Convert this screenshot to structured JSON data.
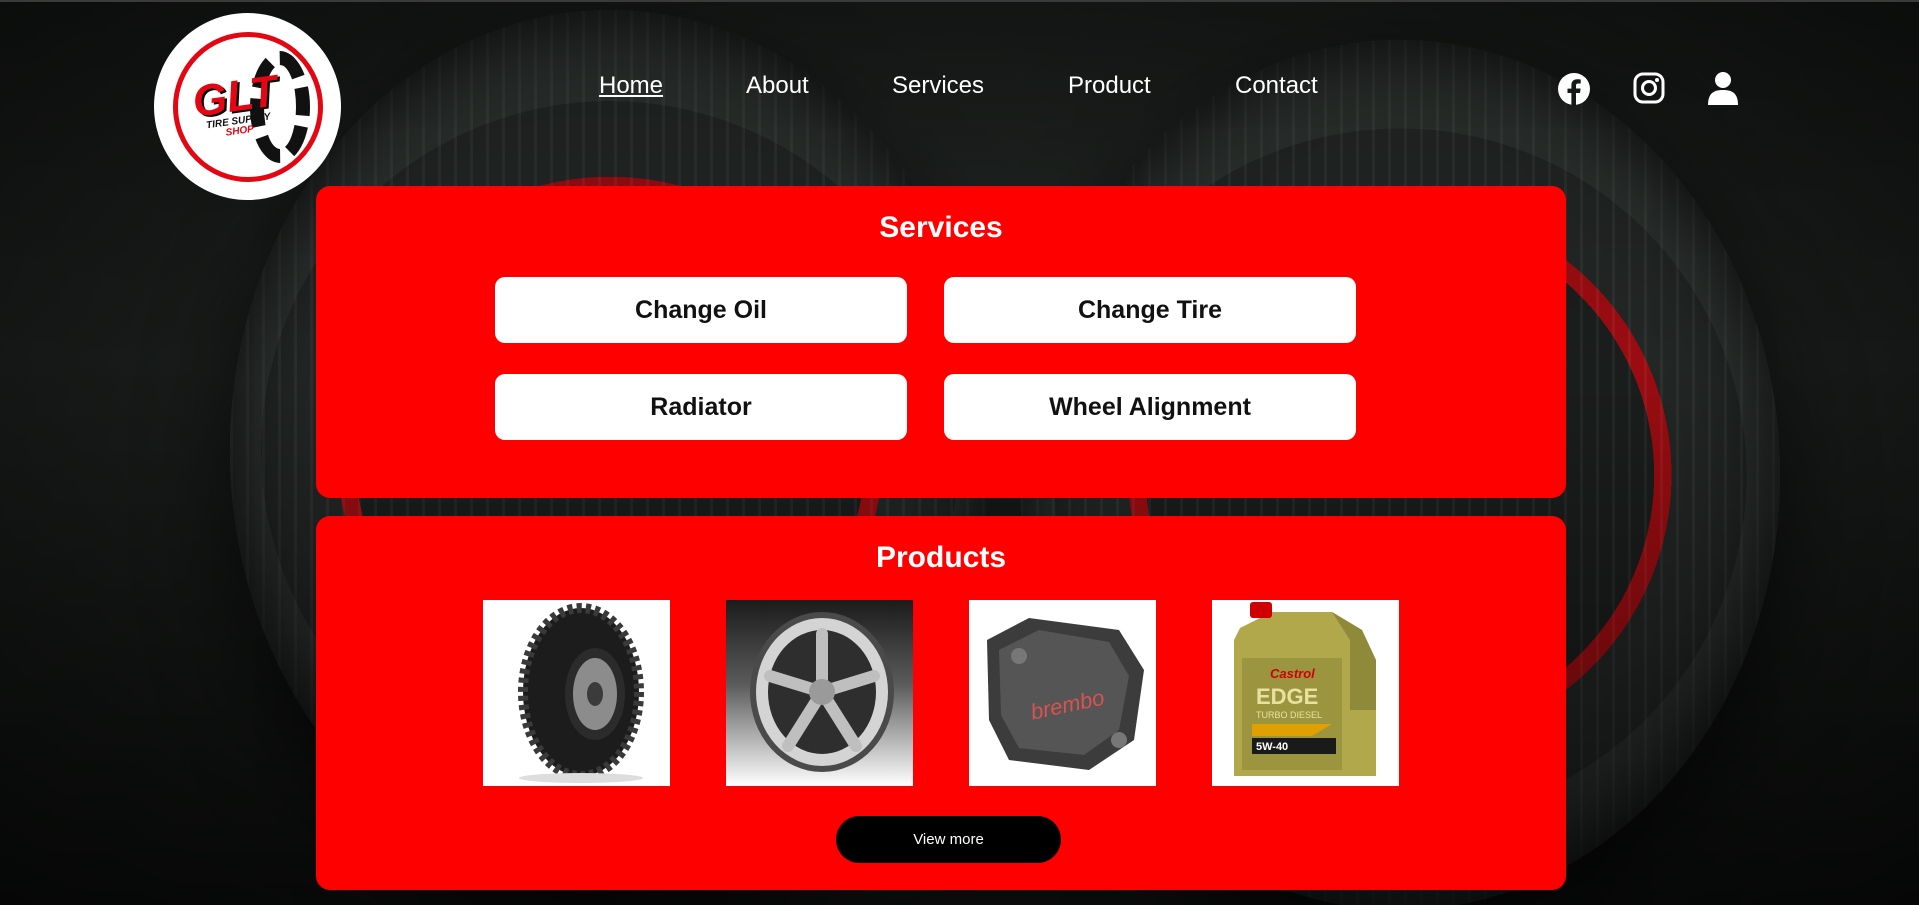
{
  "brand": {
    "logo_main": "GLT",
    "logo_sub_1": "TIRE SUPPLY",
    "logo_sub_2": "SHOP",
    "accent_color": "#ff0000"
  },
  "nav": {
    "items": [
      {
        "label": "Home",
        "active": true
      },
      {
        "label": "About"
      },
      {
        "label": "Services"
      },
      {
        "label": "Product"
      },
      {
        "label": "Contact"
      }
    ]
  },
  "social": {
    "icons": [
      "facebook-icon",
      "instagram-icon",
      "user-icon"
    ]
  },
  "services": {
    "title": "Services",
    "buttons": [
      "Change Oil",
      "Change Tire",
      "Radiator",
      "Wheel Alignment"
    ]
  },
  "products": {
    "title": "Products",
    "items": [
      "tire-image",
      "alloy-wheel-image",
      "brake-caliper-image",
      "engine-oil-image"
    ],
    "caliper_brand": "brembo",
    "oil_brand": "Castrol",
    "oil_name": "EDGE",
    "oil_sub": "TURBO DIESEL",
    "oil_grade": "5W-40",
    "view_more": "View more"
  }
}
